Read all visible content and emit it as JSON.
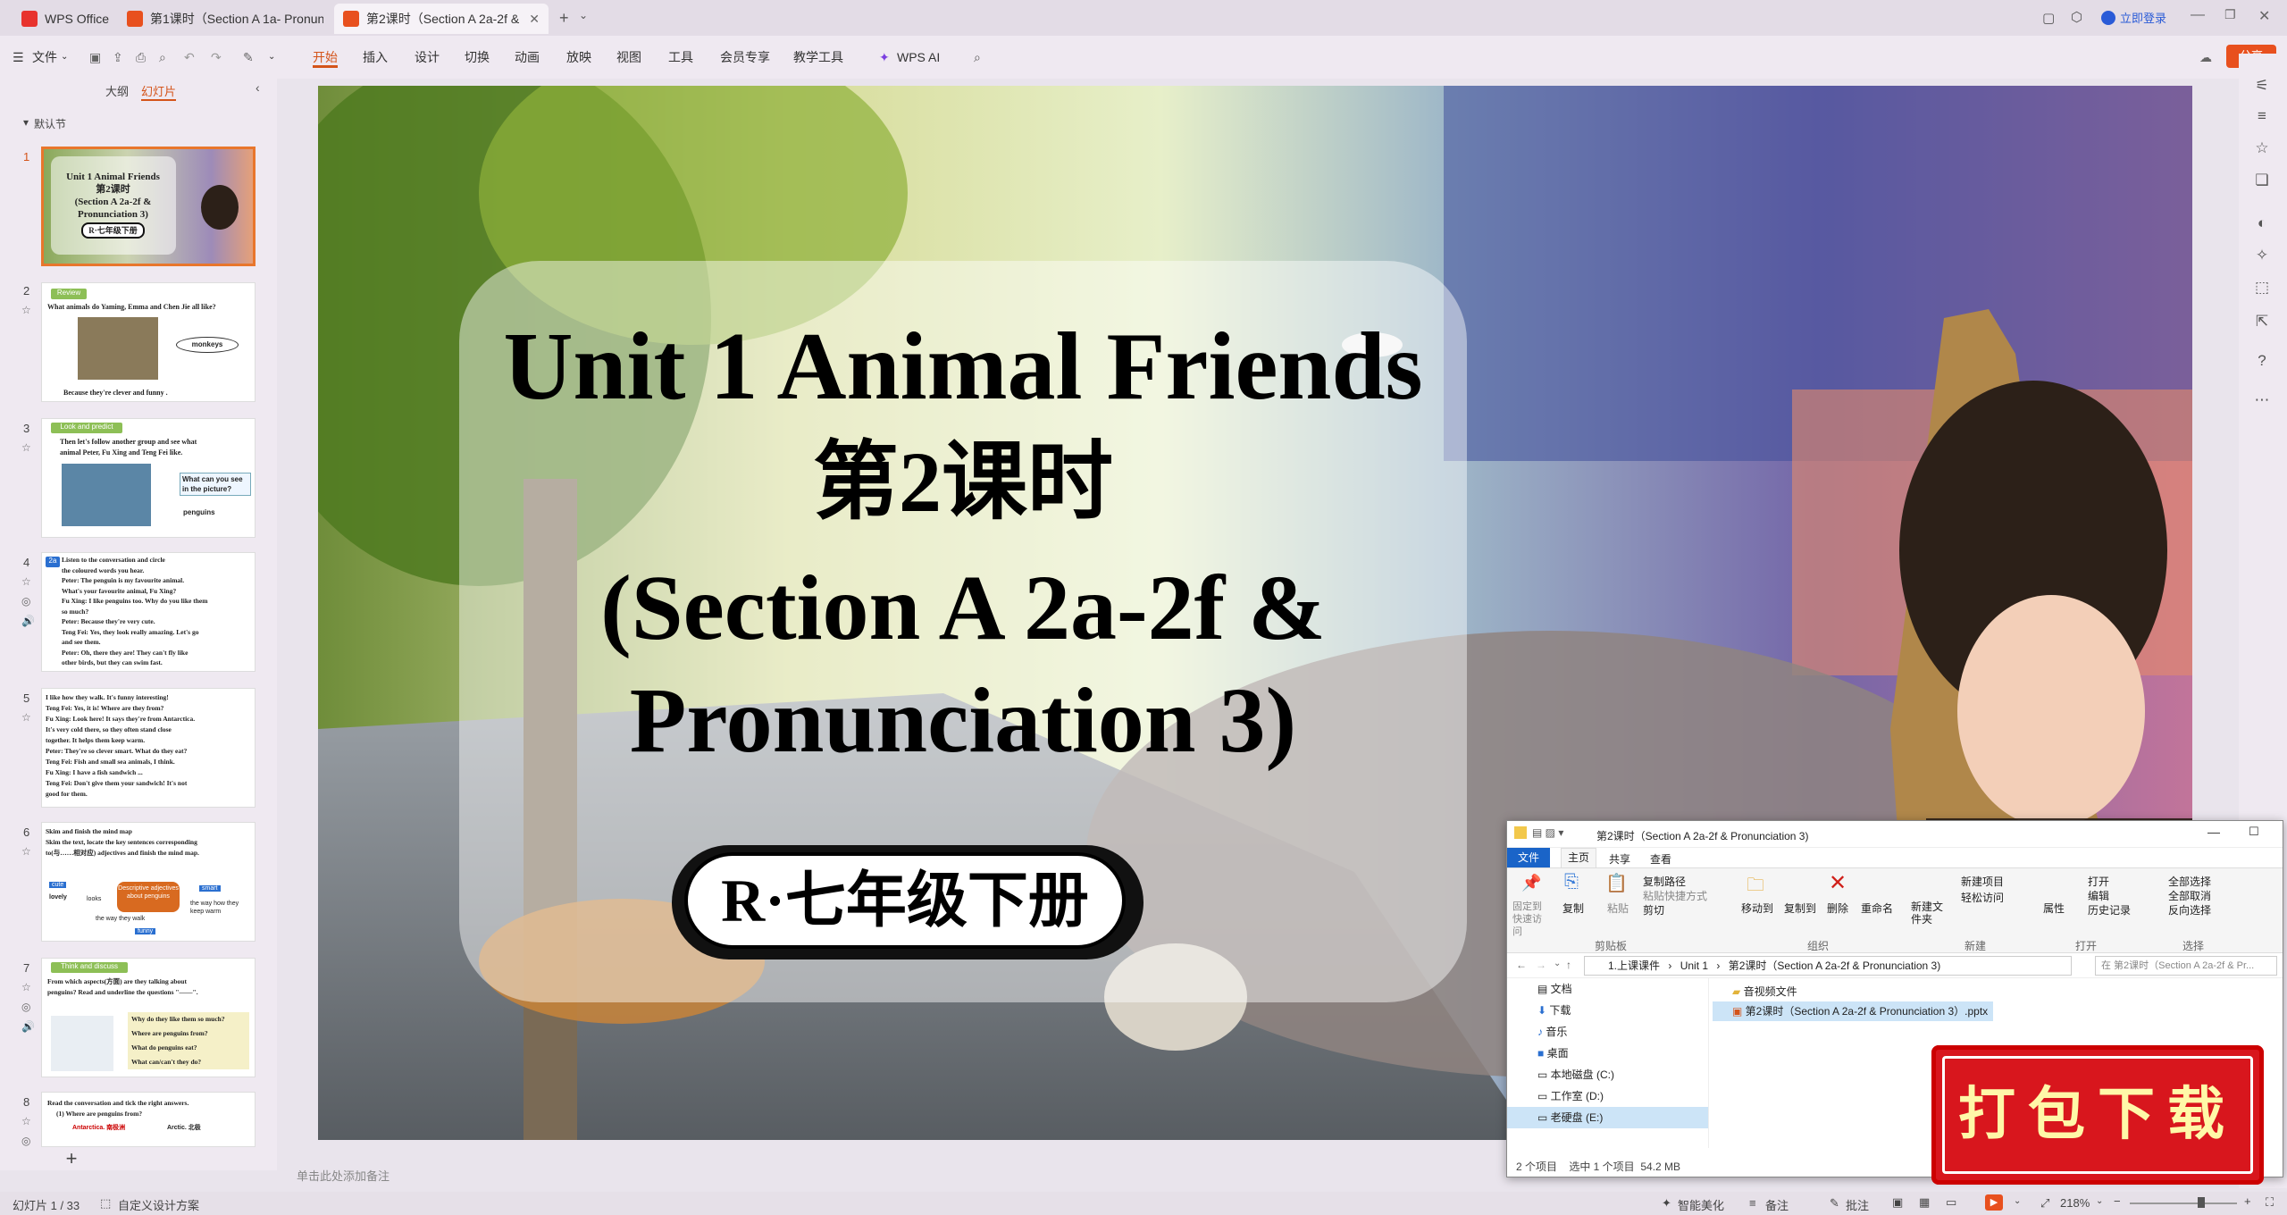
{
  "tabs": [
    {
      "label": "WPS Office"
    },
    {
      "label": "第1课时（Section A 1a- Pronuncia"
    },
    {
      "label": "第2课时（Section A 2a-2f &"
    }
  ],
  "title_right": {
    "login": "立即登录"
  },
  "menu": {
    "file": "文件",
    "items": [
      "开始",
      "插入",
      "设计",
      "切换",
      "动画",
      "放映",
      "视图",
      "工具",
      "会员专享",
      "教学工具"
    ],
    "ai": "WPS AI",
    "share": "分享"
  },
  "left": {
    "tab_outline": "大纲",
    "tab_slides": "幻灯片",
    "section": "默认节",
    "slides": [
      {
        "num": "1",
        "lines": [
          "Unit 1 Animal Friends",
          "第2课时",
          "(Section A 2a-2f &",
          "Pronunciation 3)",
          "R·七年级下册"
        ]
      },
      {
        "num": "2",
        "badge": "Review",
        "lines": [
          "What animals do Yaming, Emma and Chen Jie all like?",
          "monkeys",
          "Because they're  clever  and  funny ."
        ]
      },
      {
        "num": "3",
        "badge": "Look and predict",
        "lines": [
          "Then let's follow another group and see what",
          "animal Peter, Fu Xing and Teng Fei like.",
          "What can you see",
          "in the picture?",
          "penguins"
        ]
      },
      {
        "num": "4",
        "badge": "2a",
        "lines": [
          "Listen to the conversation and circle",
          "the coloured words you hear.",
          "Peter:    The penguin is my favourite animal.",
          "What's your favourite animal, Fu Xing?",
          "Fu Xing:  I like penguins too. Why do you like them",
          "so much?",
          "Peter:    Because they're very cute.",
          "Teng Fei: Yes, they look really amazing. Let's go",
          "and see them.",
          "Peter:    Oh, there they are! They can't fly like",
          "other birds, but they can swim fast."
        ]
      },
      {
        "num": "5",
        "lines": [
          "I like how they walk. It's funny interesting!",
          "Teng Fei:  Yes, it is! Where are they from?",
          "Fu Xing:   Look here! It says they're from Antarctica.",
          "It's very cold there, so they often stand close",
          "together. It helps them keep warm.",
          "Peter:     They're so clever smart. What do they eat?",
          "Teng Fei:  Fish and small sea animals, I think.",
          "Fu Xing:   I have a fish sandwich ...",
          "Teng Fei:  Don't give them your sandwich! It's not",
          "good for them."
        ]
      },
      {
        "num": "6",
        "lines": [
          "Skim and finish the mind map",
          "Skim the text, locate the key sentences corresponding",
          "to(与……相对应) adjectives and finish the mind map.",
          "cute",
          "lovely",
          "looks",
          "Descriptive adjectives about penguins",
          "smart",
          "the way they walk",
          "the way how they keep warm",
          "funny"
        ]
      },
      {
        "num": "7",
        "badge": "Think and discuss",
        "lines": [
          "From which aspects(方面) are they talking about",
          "penguins? Read and underline the questions \"——\".",
          "Why do they like them so much?",
          "Where are penguins from?",
          "What do penguins eat?",
          "What can/can't they do?"
        ]
      },
      {
        "num": "8",
        "lines": [
          "Read the conversation and tick the right answers.",
          "(1) Where are penguins from?",
          "Antarctica. 南极洲",
          "Arctic. 北极"
        ]
      }
    ],
    "add": "+"
  },
  "slide": {
    "title": "Unit 1 Animal Friends",
    "subtitle": "第2课时",
    "section_line1": "(Section A 2a-2f &",
    "section_line2": "Pronunciation 3)",
    "grade": "R·七年级下册"
  },
  "notes": {
    "placeholder": "单击此处添加备注"
  },
  "status": {
    "slide_count": "幻灯片 1 / 33",
    "design": "自定义设计方案",
    "beautify": "智能美化",
    "notes": "备注",
    "comments": "批注",
    "zoom": "218%"
  },
  "explorer": {
    "title": "第2课时（Section A 2a-2f & Pronunciation 3)",
    "tabs": [
      "文件",
      "主页",
      "共享",
      "查看"
    ],
    "ribbon": {
      "pin": "固定到快速访问",
      "copy": "复制",
      "paste": "粘贴",
      "copy_path": "复制路径",
      "paste_shortcut": "粘贴快捷方式",
      "cut": "剪切",
      "clipboard": "剪贴板",
      "move_to": "移动到",
      "copy_to": "复制到",
      "delete": "删除",
      "rename": "重命名",
      "organize": "组织",
      "new_item": "新建项目",
      "easy_access": "轻松访问",
      "new_folder": "新建文件夹",
      "new": "新建",
      "properties": "属性",
      "open": "打开",
      "edit": "编辑",
      "history": "历史记录",
      "open_group": "打开",
      "select_all": "全部选择",
      "select_none": "全部取消",
      "invert": "反向选择",
      "select": "选择"
    },
    "path": [
      "1.上课课件",
      "Unit 1",
      "第2课时（Section A 2a-2f & Pronunciation 3)"
    ],
    "search_placeholder": "在 第2课时（Section A 2a-2f & Pr...",
    "nav": [
      "文档",
      "下载",
      "音乐",
      "桌面",
      "本地磁盘 (C:)",
      "工作室 (D:)",
      "老硬盘 (E:)"
    ],
    "files": [
      "音视频文件",
      "第2课时（Section A 2a-2f & Pronunciation 3）.pptx"
    ],
    "status": "2 个项目    选中 1 个项目  54.2 MB"
  },
  "download": {
    "label": "打包下载"
  }
}
